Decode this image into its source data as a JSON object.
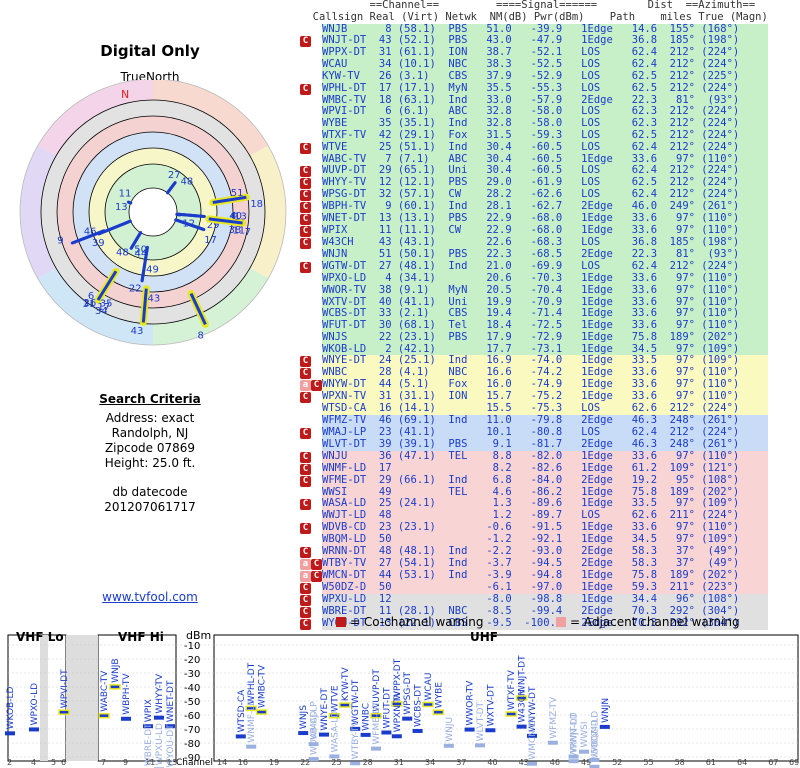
{
  "left": {
    "title": "Digital Only",
    "north_label": "TrueNorth",
    "north_marker": "N",
    "criteria_header": "Search Criteria",
    "address": "Address: exact",
    "city": "Randolph, NJ",
    "zipcode": "Zipcode 07869",
    "height": "Height: 25.0 ft.",
    "datecode_label": "db datecode",
    "datecode": "201207061717",
    "link": "www.tvfool.com"
  },
  "table_header": {
    "row1": [
      "",
      "==Channel==",
      "",
      "====Signal======",
      "Dist",
      "==Azimuth=="
    ],
    "row2": [
      "Callsign",
      "Real (Virt)",
      "Netwk",
      "NM(dB) Pwr(dBm)",
      "Path",
      "miles",
      "True (Magn)"
    ]
  },
  "colors": {
    "green": "#c8f0c8",
    "yellow": "#fafac0",
    "blue": "#c8dcf8",
    "pink": "#f8d4d4",
    "gray": "#e0e0e0",
    "co_channel": "#c01919",
    "adjacent": "#f0a0a0"
  },
  "chart_data": [
    {
      "type": "table",
      "title": "Digital Only",
      "columns": [
        "Callsign",
        "Real",
        "Virt",
        "Netwk",
        "NM(dB)",
        "Pwr(dBm)",
        "Path",
        "Dist miles",
        "True",
        "Magn",
        "Warning",
        "Band"
      ],
      "rows": [
        [
          "WNJB",
          "8",
          "(58.1)",
          "PBS",
          "51.0",
          "-39.9",
          "1Edge",
          "14.6",
          "155°",
          "(168°)",
          "",
          "green"
        ],
        [
          "WNJT-DT",
          "43",
          "(52.1)",
          "PBS",
          "43.0",
          "-47.9",
          "1Edge",
          "36.8",
          "185°",
          "(198°)",
          "C",
          "green"
        ],
        [
          "WPPX-DT",
          "31",
          "(61.1)",
          "ION",
          "38.7",
          "-52.1",
          "LOS",
          "62.4",
          "212°",
          "(224°)",
          "",
          "green"
        ],
        [
          "WCAU",
          "34",
          "(10.1)",
          "NBC",
          "38.3",
          "-52.5",
          "LOS",
          "62.4",
          "212°",
          "(224°)",
          "",
          "green"
        ],
        [
          "KYW-TV",
          "26",
          "(3.1)",
          "CBS",
          "37.9",
          "-52.9",
          "LOS",
          "62.5",
          "212°",
          "(225°)",
          "",
          "green"
        ],
        [
          "WPHL-DT",
          "17",
          "(17.1)",
          "MyN",
          "35.5",
          "-55.3",
          "LOS",
          "62.5",
          "212°",
          "(224°)",
          "C",
          "green"
        ],
        [
          "WMBC-TV",
          "18",
          "(63.1)",
          "Ind",
          "33.0",
          "-57.9",
          "2Edge",
          "22.3",
          "81°",
          "(93°)",
          "",
          "green"
        ],
        [
          "WPVI-DT",
          "6",
          "(6.1)",
          "ABC",
          "32.8",
          "-58.0",
          "LOS",
          "62.3",
          "212°",
          "(224°)",
          "",
          "green"
        ],
        [
          "WYBE",
          "35",
          "(35.1)",
          "Ind",
          "32.8",
          "-58.0",
          "LOS",
          "62.3",
          "212°",
          "(224°)",
          "",
          "green"
        ],
        [
          "WTXF-TV",
          "42",
          "(29.1)",
          "Fox",
          "31.5",
          "-59.3",
          "LOS",
          "62.5",
          "212°",
          "(224°)",
          "",
          "green"
        ],
        [
          "WTVE",
          "25",
          "(51.1)",
          "Ind",
          "30.4",
          "-60.5",
          "LOS",
          "62.4",
          "212°",
          "(224°)",
          "C",
          "green"
        ],
        [
          "WABC-TV",
          "7",
          "(7.1)",
          "ABC",
          "30.4",
          "-60.5",
          "1Edge",
          "33.6",
          "97°",
          "(110°)",
          "",
          "green"
        ],
        [
          "WUVP-DT",
          "29",
          "(65.1)",
          "Uni",
          "30.4",
          "-60.5",
          "LOS",
          "62.4",
          "212°",
          "(224°)",
          "C",
          "green"
        ],
        [
          "WHYY-TV",
          "12",
          "(12.1)",
          "PBS",
          "29.0",
          "-61.9",
          "LOS",
          "62.5",
          "212°",
          "(224°)",
          "C",
          "green"
        ],
        [
          "WPSG-DT",
          "32",
          "(57.1)",
          "CW",
          "28.2",
          "-62.6",
          "LOS",
          "62.4",
          "212°",
          "(224°)",
          "C",
          "green"
        ],
        [
          "WBPH-TV",
          "9",
          "(60.1)",
          "Ind",
          "28.1",
          "-62.7",
          "2Edge",
          "46.0",
          "249°",
          "(261°)",
          "C",
          "green"
        ],
        [
          "WNET-DT",
          "13",
          "(13.1)",
          "PBS",
          "22.9",
          "-68.0",
          "1Edge",
          "33.6",
          "97°",
          "(110°)",
          "C",
          "green"
        ],
        [
          "WPIX",
          "11",
          "(11.1)",
          "CW",
          "22.9",
          "-68.0",
          "1Edge",
          "33.6",
          "97°",
          "(110°)",
          "C",
          "green"
        ],
        [
          "W43CH",
          "43",
          "(43.1)",
          "",
          "22.6",
          "-68.3",
          "LOS",
          "36.8",
          "185°",
          "(198°)",
          "C",
          "green"
        ],
        [
          "WNJN",
          "51",
          "(50.1)",
          "PBS",
          "22.3",
          "-68.5",
          "2Edge",
          "22.3",
          "81°",
          "(93°)",
          "",
          "green"
        ],
        [
          "WGTW-DT",
          "27",
          "(48.1)",
          "Ind",
          "21.0",
          "-69.9",
          "LOS",
          "62.4",
          "212°",
          "(224°)",
          "C",
          "green"
        ],
        [
          "WPXO-LD",
          "4",
          "(34.1)",
          "",
          "20.6",
          "-70.3",
          "1Edge",
          "33.6",
          "97°",
          "(110°)",
          "",
          "green"
        ],
        [
          "WWOR-TV",
          "38",
          "(9.1)",
          "MyN",
          "20.5",
          "-70.4",
          "1Edge",
          "33.6",
          "97°",
          "(110°)",
          "",
          "green"
        ],
        [
          "WXTV-DT",
          "40",
          "(41.1)",
          "Uni",
          "19.9",
          "-70.9",
          "1Edge",
          "33.6",
          "97°",
          "(110°)",
          "",
          "green"
        ],
        [
          "WCBS-DT",
          "33",
          "(2.1)",
          "CBS",
          "19.4",
          "-71.4",
          "1Edge",
          "33.6",
          "97°",
          "(110°)",
          "",
          "green"
        ],
        [
          "WFUT-DT",
          "30",
          "(68.1)",
          "Tel",
          "18.4",
          "-72.5",
          "1Edge",
          "33.6",
          "97°",
          "(110°)",
          "",
          "green"
        ],
        [
          "WNJS",
          "22",
          "(23.1)",
          "PBS",
          "17.9",
          "-72.9",
          "1Edge",
          "75.8",
          "189°",
          "(202°)",
          "",
          "green"
        ],
        [
          "WKOB-LD",
          "2",
          "(42.1)",
          "",
          "17.7",
          "-73.1",
          "1Edge",
          "34.5",
          "97°",
          "(109°)",
          "",
          "green"
        ],
        [
          "WNYE-DT",
          "24",
          "(25.1)",
          "Ind",
          "16.9",
          "-74.0",
          "1Edge",
          "33.5",
          "97°",
          "(109°)",
          "C",
          "yellow"
        ],
        [
          "WNBC",
          "28",
          "(4.1)",
          "NBC",
          "16.6",
          "-74.2",
          "1Edge",
          "33.6",
          "97°",
          "(110°)",
          "C",
          "yellow"
        ],
        [
          "WNYW-DT",
          "44",
          "(5.1)",
          "Fox",
          "16.0",
          "-74.9",
          "1Edge",
          "33.6",
          "97°",
          "(110°)",
          "CA",
          "yellow"
        ],
        [
          "WPXN-TV",
          "31",
          "(31.1)",
          "ION",
          "15.7",
          "-75.2",
          "1Edge",
          "33.6",
          "97°",
          "(110°)",
          "C",
          "yellow"
        ],
        [
          "WTSD-CA",
          "16",
          "(14.1)",
          "",
          "15.5",
          "-75.3",
          "LOS",
          "62.6",
          "212°",
          "(224°)",
          "",
          "yellow"
        ],
        [
          "WFMZ-TV",
          "46",
          "(69.1)",
          "Ind",
          "11.0",
          "-79.8",
          "2Edge",
          "46.3",
          "248°",
          "(261°)",
          "",
          "blue"
        ],
        [
          "WMAJ-LP",
          "23",
          "(41.1)",
          "",
          "10.1",
          "-80.8",
          "LOS",
          "62.4",
          "212°",
          "(224°)",
          "C",
          "blue"
        ],
        [
          "WLVT-DT",
          "39",
          "(39.1)",
          "PBS",
          "9.1",
          "-81.7",
          "2Edge",
          "46.3",
          "248°",
          "(261°)",
          "",
          "blue"
        ],
        [
          "WNJU",
          "36",
          "(47.1)",
          "TEL",
          "8.8",
          "-82.0",
          "1Edge",
          "33.6",
          "97°",
          "(110°)",
          "C",
          "pink"
        ],
        [
          "WNMF-LD",
          "17",
          "",
          "",
          "8.2",
          "-82.6",
          "1Edge",
          "61.2",
          "109°",
          "(121°)",
          "C",
          "pink"
        ],
        [
          "WFME-DT",
          "29",
          "(66.1)",
          "Ind",
          "6.8",
          "-84.0",
          "2Edge",
          "19.2",
          "95°",
          "(108°)",
          "C",
          "pink"
        ],
        [
          "WWSI",
          "49",
          "",
          "TEL",
          "4.6",
          "-86.2",
          "1Edge",
          "75.8",
          "189°",
          "(202°)",
          "",
          "pink"
        ],
        [
          "WASA-LD",
          "25",
          "(24.1)",
          "",
          "1.3",
          "-89.6",
          "1Edge",
          "33.5",
          "97°",
          "(109°)",
          "C",
          "pink"
        ],
        [
          "WWJT-LD",
          "48",
          "",
          "",
          "1.2",
          "-89.7",
          "LOS",
          "62.6",
          "211°",
          "(224°)",
          "",
          "pink"
        ],
        [
          "WDVB-CD",
          "23",
          "(23.1)",
          "",
          "-0.6",
          "-91.5",
          "1Edge",
          "33.6",
          "97°",
          "(110°)",
          "C",
          "pink"
        ],
        [
          "WBQM-LD",
          "50",
          "",
          "",
          "-1.2",
          "-92.1",
          "1Edge",
          "34.5",
          "97°",
          "(109°)",
          "",
          "pink"
        ],
        [
          "WRNN-DT",
          "48",
          "(48.1)",
          "Ind",
          "-2.2",
          "-93.0",
          "2Edge",
          "58.3",
          "37°",
          "(49°)",
          "C",
          "pink"
        ],
        [
          "WTBY-TV",
          "27",
          "(54.1)",
          "Ind",
          "-3.7",
          "-94.5",
          "2Edge",
          "58.3",
          "37°",
          "(49°)",
          "CA",
          "pink"
        ],
        [
          "WMCN-DT",
          "44",
          "(53.1)",
          "Ind",
          "-3.9",
          "-94.8",
          "1Edge",
          "75.8",
          "189°",
          "(202°)",
          "CA",
          "pink"
        ],
        [
          "W50DZ-D",
          "50",
          "",
          "",
          "-6.1",
          "-97.0",
          "1Edge",
          "59.3",
          "211°",
          "(223°)",
          "C",
          "pink"
        ],
        [
          "WPXU-LD",
          "12",
          "",
          "",
          "-8.0",
          "-98.8",
          "1Edge",
          "34.4",
          "96°",
          "(108°)",
          "C",
          "gray"
        ],
        [
          "WBRE-DT",
          "11",
          "(28.1)",
          "NBC",
          "-8.5",
          "-99.4",
          "2Edge",
          "70.3",
          "292°",
          "(304°)",
          "C",
          "gray"
        ],
        [
          "WYOU-DT",
          "13",
          "(22.1)",
          "CBS",
          "-9.5",
          "-100.4",
          "2Edge",
          "70.3",
          "292°",
          "(304°)",
          "C",
          "gray"
        ]
      ]
    },
    {
      "type": "scatter",
      "title": "",
      "description_source": "polar station plot: azimuth (true degrees) vs noise margin",
      "axis": "azimuth",
      "ring_levels": [
        50,
        40,
        30,
        20,
        10,
        0,
        -10
      ],
      "points_ref": "derived from table rows (azimuth True, NM)"
    },
    {
      "type": "bar",
      "title": "",
      "ylabel": "dBm",
      "ylim": [
        -90,
        -10
      ],
      "yticks": [
        -10,
        -20,
        -30,
        -40,
        -50,
        -60,
        -70,
        -80,
        -90
      ],
      "bands": [
        "VHF Lo",
        "VHF Hi",
        "UHF"
      ],
      "xlabel": "Channel",
      "vhf_lo_ticks": [
        2,
        4,
        5,
        6
      ],
      "vhf_hi_ticks": [
        7,
        9,
        11,
        13
      ],
      "uhf_ticks": [
        14,
        16,
        19,
        22,
        25,
        28,
        31,
        34,
        37,
        40,
        43,
        46,
        49,
        52,
        55,
        58,
        61,
        64,
        67,
        69
      ],
      "legend": [
        {
          "mark": "C",
          "label": "= Co-channel warning"
        },
        {
          "mark": "a",
          "label": "= Adjacent channel warning"
        }
      ]
    }
  ]
}
